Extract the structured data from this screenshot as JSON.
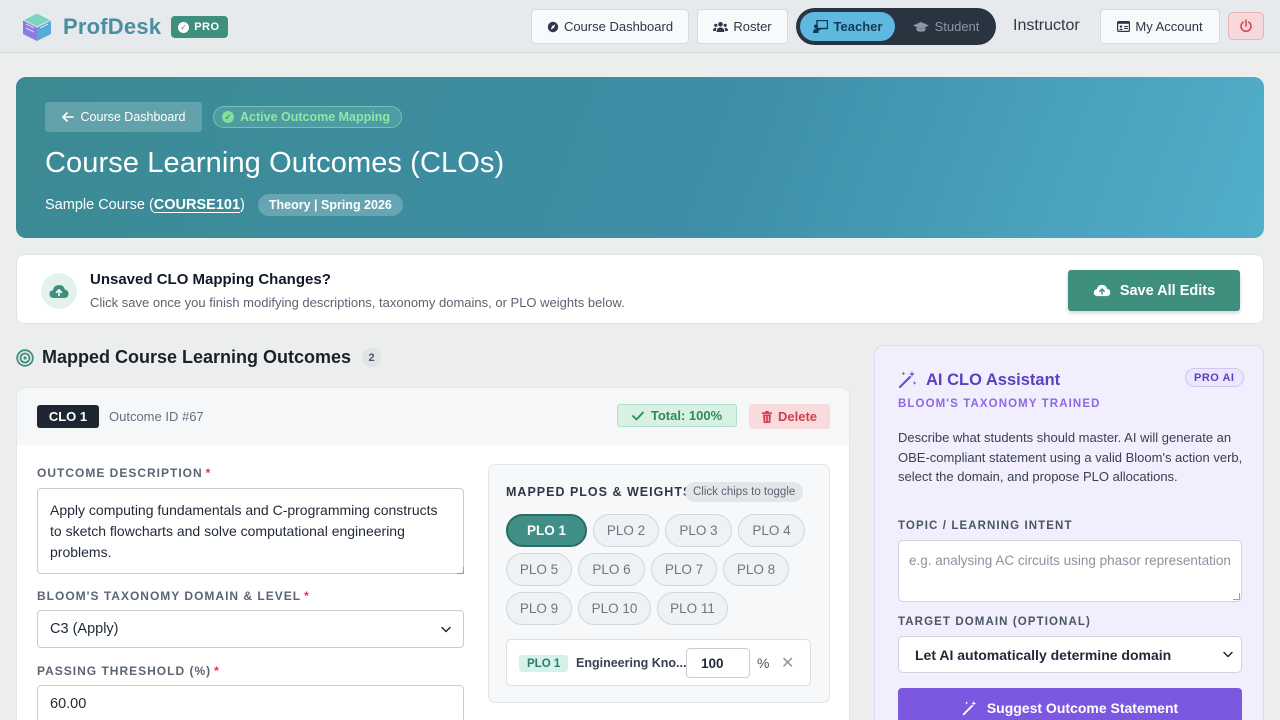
{
  "nav": {
    "brand": "ProfDesk",
    "pro_badge": "PRO",
    "course_dashboard": "Course Dashboard",
    "roster": "Roster",
    "teacher": "Teacher",
    "student": "Student",
    "role": "Instructor",
    "my_account": "My Account"
  },
  "hero": {
    "back_label": "Course Dashboard",
    "status_pill": "Active Outcome Mapping",
    "title": "Course Learning Outcomes (CLOs)",
    "course_prefix": "Sample Course (",
    "course_code": "COURSE101",
    "course_suffix": ")",
    "term": "Theory | Spring 2026"
  },
  "unsaved": {
    "title": "Unsaved CLO Mapping Changes?",
    "description": "Click save once you finish modifying descriptions, taxonomy domains, or PLO weights below.",
    "save_label": "Save All Edits"
  },
  "section": {
    "title": "Mapped Course Learning Outcomes",
    "count": "2"
  },
  "clo": {
    "tag": "CLO 1",
    "outcome_id": "Outcome ID #67",
    "total": "Total: 100%",
    "delete_label": "Delete",
    "description_label": "OUTCOME DESCRIPTION",
    "description_value": "Apply computing fundamentals and C-programming constructs to sketch flowcharts and solve computational engineering problems.",
    "bloom_label": "BLOOM'S TAXONOMY DOMAIN & LEVEL",
    "bloom_value": "C3 (Apply)",
    "threshold_label": "PASSING THRESHOLD (%)",
    "threshold_value": "60.00",
    "required_mark": "*",
    "plo_panel_title": "MAPPED PLOS & WEIGHTS",
    "plo_hint": "Click chips to toggle",
    "plos": [
      "PLO 1",
      "PLO 2",
      "PLO 3",
      "PLO 4",
      "PLO 5",
      "PLO 6",
      "PLO 7",
      "PLO 8",
      "PLO 9",
      "PLO 10",
      "PLO 11"
    ],
    "selected_plo": "PLO 1",
    "weight_row": {
      "tag": "PLO 1",
      "name": "Engineering Kno...",
      "weight": "100",
      "unit": "%"
    }
  },
  "ai": {
    "title": "AI CLO Assistant",
    "pro_badge": "PRO AI",
    "subtitle": "BLOOM'S TAXONOMY TRAINED",
    "description": "Describe what students should master. AI will generate an OBE-compliant statement using a valid Bloom's action verb, select the domain, and propose PLO allocations.",
    "topic_label": "TOPIC / LEARNING INTENT",
    "topic_placeholder": "e.g. analysing AC circuits using phasor representation",
    "domain_label": "TARGET DOMAIN (OPTIONAL)",
    "domain_value": "Let AI automatically determine domain",
    "suggest_label": "Suggest Outcome Statement"
  },
  "colors": {
    "brand": "#4a8f9f",
    "primary_teal": "#3f8f7f",
    "ai_purple": "#7c58e0",
    "danger": "#d03f4e"
  }
}
